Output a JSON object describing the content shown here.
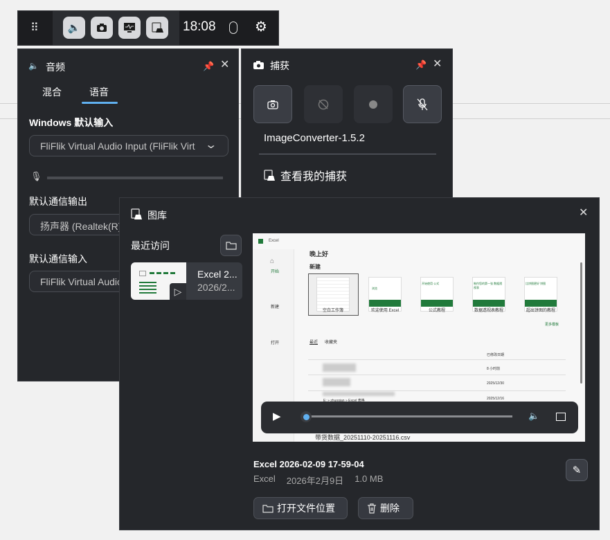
{
  "topbar": {
    "time": "18:08",
    "icons": [
      "widget-menu-icon",
      "audio-icon",
      "capture-icon",
      "performance-icon",
      "gallery-icon",
      "mouse-icon",
      "settings-icon"
    ]
  },
  "audio": {
    "title": "音频",
    "tabs": [
      {
        "label": "混合"
      },
      {
        "label": "语音",
        "active": true
      }
    ],
    "input_label": "Windows 默认输入",
    "input_value": "FliFlik Virtual Audio Input (FliFlik Virt",
    "comm_out_label": "默认通信输出",
    "comm_out_value": "扬声器 (Realtek(R) Audio)",
    "comm_in_label": "默认通信输入",
    "comm_in_value": "FliFlik Virtual Audio Input"
  },
  "capture": {
    "title": "捕获",
    "app_name": "ImageConverter-1.5.2",
    "view_link": "查看我的捕获"
  },
  "gallery": {
    "title": "图库",
    "recent_label": "最近访问",
    "item": {
      "title": "Excel 2...",
      "date": "2026/2..."
    },
    "file_title": "Excel 2026-02-09 17-59-04",
    "app": "Excel",
    "date": "2026年2月9日",
    "size": "1.0 MB",
    "open_location": "打开文件位置",
    "delete": "删除",
    "player": {
      "progress": 0
    }
  },
  "preview": {
    "app": "Excel",
    "greeting": "晚上好",
    "new_section": "新建",
    "nav": [
      "开始",
      "新建",
      "打开"
    ],
    "templates": [
      "空白工作簿",
      "欢迎使用 Excel",
      "公式教程",
      "数据透视表教程",
      "超出饼图的教程"
    ],
    "tile_texts": [
      "浏览",
      "开始使用 公式",
      "制作您的第一张 数据透视表",
      "比饼图更好 饼图"
    ],
    "more_templates": "更多模板",
    "tabs": [
      "最近",
      "收藏夹"
    ],
    "modified_header": "已修改日期",
    "dates": [
      "8 小时前",
      "2025/12/30",
      "2025/12/16"
    ],
    "path_text": "E: » zhuoqian » Excel 表格",
    "last_file": "带货数据_20251110-20251116.csv"
  },
  "colors": {
    "accent": "#60b0f0",
    "panel": "#25272b",
    "excel_green": "#217a3b"
  }
}
